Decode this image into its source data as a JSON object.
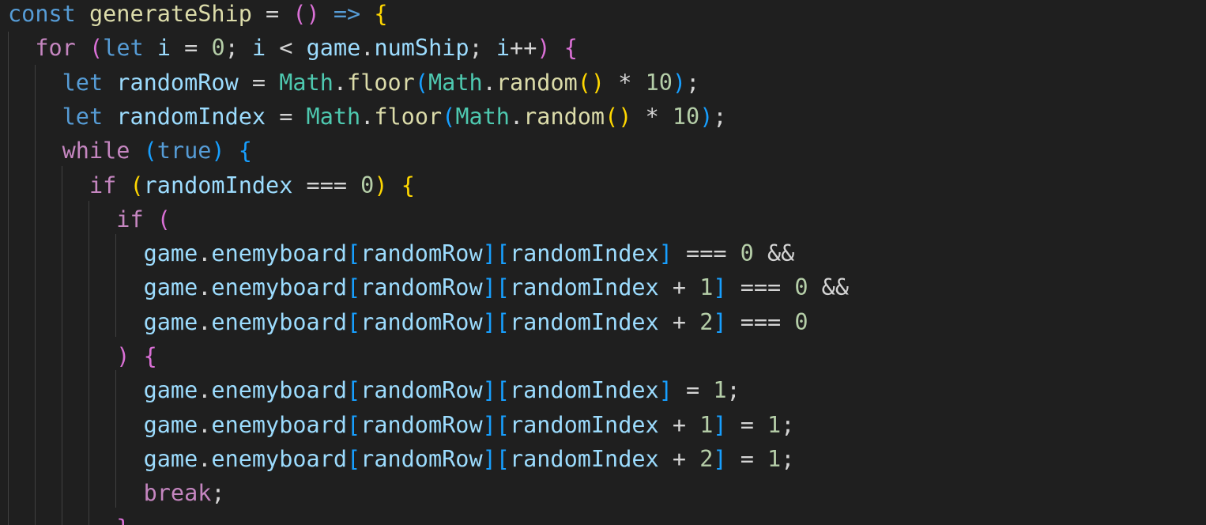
{
  "editor": {
    "lines": [
      [
        {
          "t": "const",
          "c": "dkw"
        },
        {
          "t": " "
        },
        {
          "t": "generateShip",
          "c": "fn"
        },
        {
          "t": " = ",
          "c": "op"
        },
        {
          "t": "()",
          "c": "b2"
        },
        {
          "t": " "
        },
        {
          "t": "=>",
          "c": "dkw"
        },
        {
          "t": " "
        },
        {
          "t": "{",
          "c": "b1"
        }
      ],
      [
        {
          "t": "  "
        },
        {
          "t": "for",
          "c": "kw"
        },
        {
          "t": " "
        },
        {
          "t": "(",
          "c": "b2"
        },
        {
          "t": "let",
          "c": "dkw"
        },
        {
          "t": " "
        },
        {
          "t": "i",
          "c": "var"
        },
        {
          "t": " = ",
          "c": "op"
        },
        {
          "t": "0",
          "c": "num"
        },
        {
          "t": "; ",
          "c": "op"
        },
        {
          "t": "i",
          "c": "var"
        },
        {
          "t": " < ",
          "c": "op"
        },
        {
          "t": "game",
          "c": "var"
        },
        {
          "t": ".",
          "c": "op"
        },
        {
          "t": "numShip",
          "c": "var"
        },
        {
          "t": "; ",
          "c": "op"
        },
        {
          "t": "i",
          "c": "var"
        },
        {
          "t": "++",
          "c": "op"
        },
        {
          "t": ")",
          "c": "b2"
        },
        {
          "t": " "
        },
        {
          "t": "{",
          "c": "b2"
        }
      ],
      [
        {
          "t": "    "
        },
        {
          "t": "let",
          "c": "dkw"
        },
        {
          "t": " "
        },
        {
          "t": "randomRow",
          "c": "var"
        },
        {
          "t": " = ",
          "c": "op"
        },
        {
          "t": "Math",
          "c": "cls"
        },
        {
          "t": ".",
          "c": "op"
        },
        {
          "t": "floor",
          "c": "fn"
        },
        {
          "t": "(",
          "c": "b3"
        },
        {
          "t": "Math",
          "c": "cls"
        },
        {
          "t": ".",
          "c": "op"
        },
        {
          "t": "random",
          "c": "fn"
        },
        {
          "t": "()",
          "c": "b1"
        },
        {
          "t": " * ",
          "c": "op"
        },
        {
          "t": "10",
          "c": "num"
        },
        {
          "t": ")",
          "c": "b3"
        },
        {
          "t": ";",
          "c": "op"
        }
      ],
      [
        {
          "t": "    "
        },
        {
          "t": "let",
          "c": "dkw"
        },
        {
          "t": " "
        },
        {
          "t": "randomIndex",
          "c": "var"
        },
        {
          "t": " = ",
          "c": "op"
        },
        {
          "t": "Math",
          "c": "cls"
        },
        {
          "t": ".",
          "c": "op"
        },
        {
          "t": "floor",
          "c": "fn"
        },
        {
          "t": "(",
          "c": "b3"
        },
        {
          "t": "Math",
          "c": "cls"
        },
        {
          "t": ".",
          "c": "op"
        },
        {
          "t": "random",
          "c": "fn"
        },
        {
          "t": "()",
          "c": "b1"
        },
        {
          "t": " * ",
          "c": "op"
        },
        {
          "t": "10",
          "c": "num"
        },
        {
          "t": ")",
          "c": "b3"
        },
        {
          "t": ";",
          "c": "op"
        }
      ],
      [
        {
          "t": "    "
        },
        {
          "t": "while",
          "c": "kw"
        },
        {
          "t": " "
        },
        {
          "t": "(",
          "c": "b3"
        },
        {
          "t": "true",
          "c": "dkw"
        },
        {
          "t": ")",
          "c": "b3"
        },
        {
          "t": " "
        },
        {
          "t": "{",
          "c": "b3"
        }
      ],
      [
        {
          "t": "      "
        },
        {
          "t": "if",
          "c": "kw"
        },
        {
          "t": " "
        },
        {
          "t": "(",
          "c": "b1"
        },
        {
          "t": "randomIndex",
          "c": "var"
        },
        {
          "t": " === ",
          "c": "op"
        },
        {
          "t": "0",
          "c": "num"
        },
        {
          "t": ")",
          "c": "b1"
        },
        {
          "t": " "
        },
        {
          "t": "{",
          "c": "b1"
        }
      ],
      [
        {
          "t": "        "
        },
        {
          "t": "if",
          "c": "kw"
        },
        {
          "t": " "
        },
        {
          "t": "(",
          "c": "b2"
        }
      ],
      [
        {
          "t": "          "
        },
        {
          "t": "game",
          "c": "var"
        },
        {
          "t": ".",
          "c": "op"
        },
        {
          "t": "enemyboard",
          "c": "var"
        },
        {
          "t": "[",
          "c": "b3"
        },
        {
          "t": "randomRow",
          "c": "var"
        },
        {
          "t": "]",
          "c": "b3"
        },
        {
          "t": "[",
          "c": "b3"
        },
        {
          "t": "randomIndex",
          "c": "var"
        },
        {
          "t": "]",
          "c": "b3"
        },
        {
          "t": " === ",
          "c": "op"
        },
        {
          "t": "0",
          "c": "num"
        },
        {
          "t": " &&",
          "c": "op"
        }
      ],
      [
        {
          "t": "          "
        },
        {
          "t": "game",
          "c": "var"
        },
        {
          "t": ".",
          "c": "op"
        },
        {
          "t": "enemyboard",
          "c": "var"
        },
        {
          "t": "[",
          "c": "b3"
        },
        {
          "t": "randomRow",
          "c": "var"
        },
        {
          "t": "]",
          "c": "b3"
        },
        {
          "t": "[",
          "c": "b3"
        },
        {
          "t": "randomIndex",
          "c": "var"
        },
        {
          "t": " + ",
          "c": "op"
        },
        {
          "t": "1",
          "c": "num"
        },
        {
          "t": "]",
          "c": "b3"
        },
        {
          "t": " === ",
          "c": "op"
        },
        {
          "t": "0",
          "c": "num"
        },
        {
          "t": " &&",
          "c": "op"
        }
      ],
      [
        {
          "t": "          "
        },
        {
          "t": "game",
          "c": "var"
        },
        {
          "t": ".",
          "c": "op"
        },
        {
          "t": "enemyboard",
          "c": "var"
        },
        {
          "t": "[",
          "c": "b3"
        },
        {
          "t": "randomRow",
          "c": "var"
        },
        {
          "t": "]",
          "c": "b3"
        },
        {
          "t": "[",
          "c": "b3"
        },
        {
          "t": "randomIndex",
          "c": "var"
        },
        {
          "t": " + ",
          "c": "op"
        },
        {
          "t": "2",
          "c": "num"
        },
        {
          "t": "]",
          "c": "b3"
        },
        {
          "t": " === ",
          "c": "op"
        },
        {
          "t": "0",
          "c": "num"
        }
      ],
      [
        {
          "t": "        "
        },
        {
          "t": ")",
          "c": "b2"
        },
        {
          "t": " "
        },
        {
          "t": "{",
          "c": "b2"
        }
      ],
      [
        {
          "t": "          "
        },
        {
          "t": "game",
          "c": "var"
        },
        {
          "t": ".",
          "c": "op"
        },
        {
          "t": "enemyboard",
          "c": "var"
        },
        {
          "t": "[",
          "c": "b3"
        },
        {
          "t": "randomRow",
          "c": "var"
        },
        {
          "t": "]",
          "c": "b3"
        },
        {
          "t": "[",
          "c": "b3"
        },
        {
          "t": "randomIndex",
          "c": "var"
        },
        {
          "t": "]",
          "c": "b3"
        },
        {
          "t": " = ",
          "c": "op"
        },
        {
          "t": "1",
          "c": "num"
        },
        {
          "t": ";",
          "c": "op"
        }
      ],
      [
        {
          "t": "          "
        },
        {
          "t": "game",
          "c": "var"
        },
        {
          "t": ".",
          "c": "op"
        },
        {
          "t": "enemyboard",
          "c": "var"
        },
        {
          "t": "[",
          "c": "b3"
        },
        {
          "t": "randomRow",
          "c": "var"
        },
        {
          "t": "]",
          "c": "b3"
        },
        {
          "t": "[",
          "c": "b3"
        },
        {
          "t": "randomIndex",
          "c": "var"
        },
        {
          "t": " + ",
          "c": "op"
        },
        {
          "t": "1",
          "c": "num"
        },
        {
          "t": "]",
          "c": "b3"
        },
        {
          "t": " = ",
          "c": "op"
        },
        {
          "t": "1",
          "c": "num"
        },
        {
          "t": ";",
          "c": "op"
        }
      ],
      [
        {
          "t": "          "
        },
        {
          "t": "game",
          "c": "var"
        },
        {
          "t": ".",
          "c": "op"
        },
        {
          "t": "enemyboard",
          "c": "var"
        },
        {
          "t": "[",
          "c": "b3"
        },
        {
          "t": "randomRow",
          "c": "var"
        },
        {
          "t": "]",
          "c": "b3"
        },
        {
          "t": "[",
          "c": "b3"
        },
        {
          "t": "randomIndex",
          "c": "var"
        },
        {
          "t": " + ",
          "c": "op"
        },
        {
          "t": "2",
          "c": "num"
        },
        {
          "t": "]",
          "c": "b3"
        },
        {
          "t": " = ",
          "c": "op"
        },
        {
          "t": "1",
          "c": "num"
        },
        {
          "t": ";",
          "c": "op"
        }
      ],
      [
        {
          "t": "          "
        },
        {
          "t": "break",
          "c": "kw"
        },
        {
          "t": ";",
          "c": "op"
        }
      ],
      [
        {
          "t": "        "
        },
        {
          "t": "}",
          "c": "b2"
        }
      ]
    ]
  }
}
